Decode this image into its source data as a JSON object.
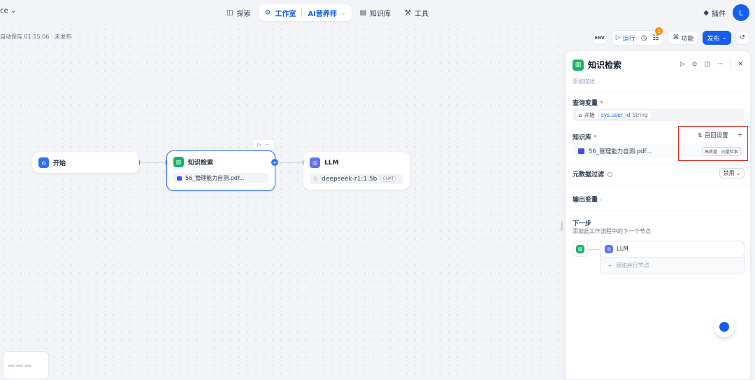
{
  "topbar": {
    "workspace": "ce",
    "nav": {
      "explore": "探索",
      "studio": "工作室",
      "app_name": "AI营养师",
      "knowledge": "知识库",
      "tools": "工具"
    },
    "plugins": "插件",
    "avatar_initial": "L"
  },
  "canvas": {
    "autosave": "自动保存 01:15:06 · 未发布",
    "toolbar": {
      "env_label": "ENV",
      "run": "运行",
      "badge": "1",
      "features": "功能",
      "publish": "发布"
    },
    "nodes": {
      "start": {
        "title": "开始"
      },
      "knowledge": {
        "title": "知识检索",
        "file": "56_管理能力自测.pdf..."
      },
      "llm": {
        "title": "LLM",
        "model": "deepseek-r1:1.5b",
        "model_tag": "CHAT"
      }
    }
  },
  "panel": {
    "title": "知识检索",
    "desc_placeholder": "添加描述...",
    "query_var": {
      "label": "查询变量",
      "req": "*",
      "source": "开始",
      "var": "sys.user_id",
      "type": "String"
    },
    "kb": {
      "label": "知识库",
      "req": "*",
      "retrieval": "召回设置",
      "file": "56_管理能力自测.pdf...",
      "tags": "高质量 · 向量检索"
    },
    "metadata": {
      "label": "元数据过滤",
      "select": "禁用"
    },
    "output": {
      "label": "输出变量"
    },
    "next": {
      "label": "下一步",
      "sub": "添加此工作流程中的下一个节点",
      "llm": "LLM",
      "add_parallel": "添加并行节点"
    }
  },
  "colors": {
    "accent": "#155eef",
    "green": "#17b26a",
    "highlight": "#d92d20"
  }
}
